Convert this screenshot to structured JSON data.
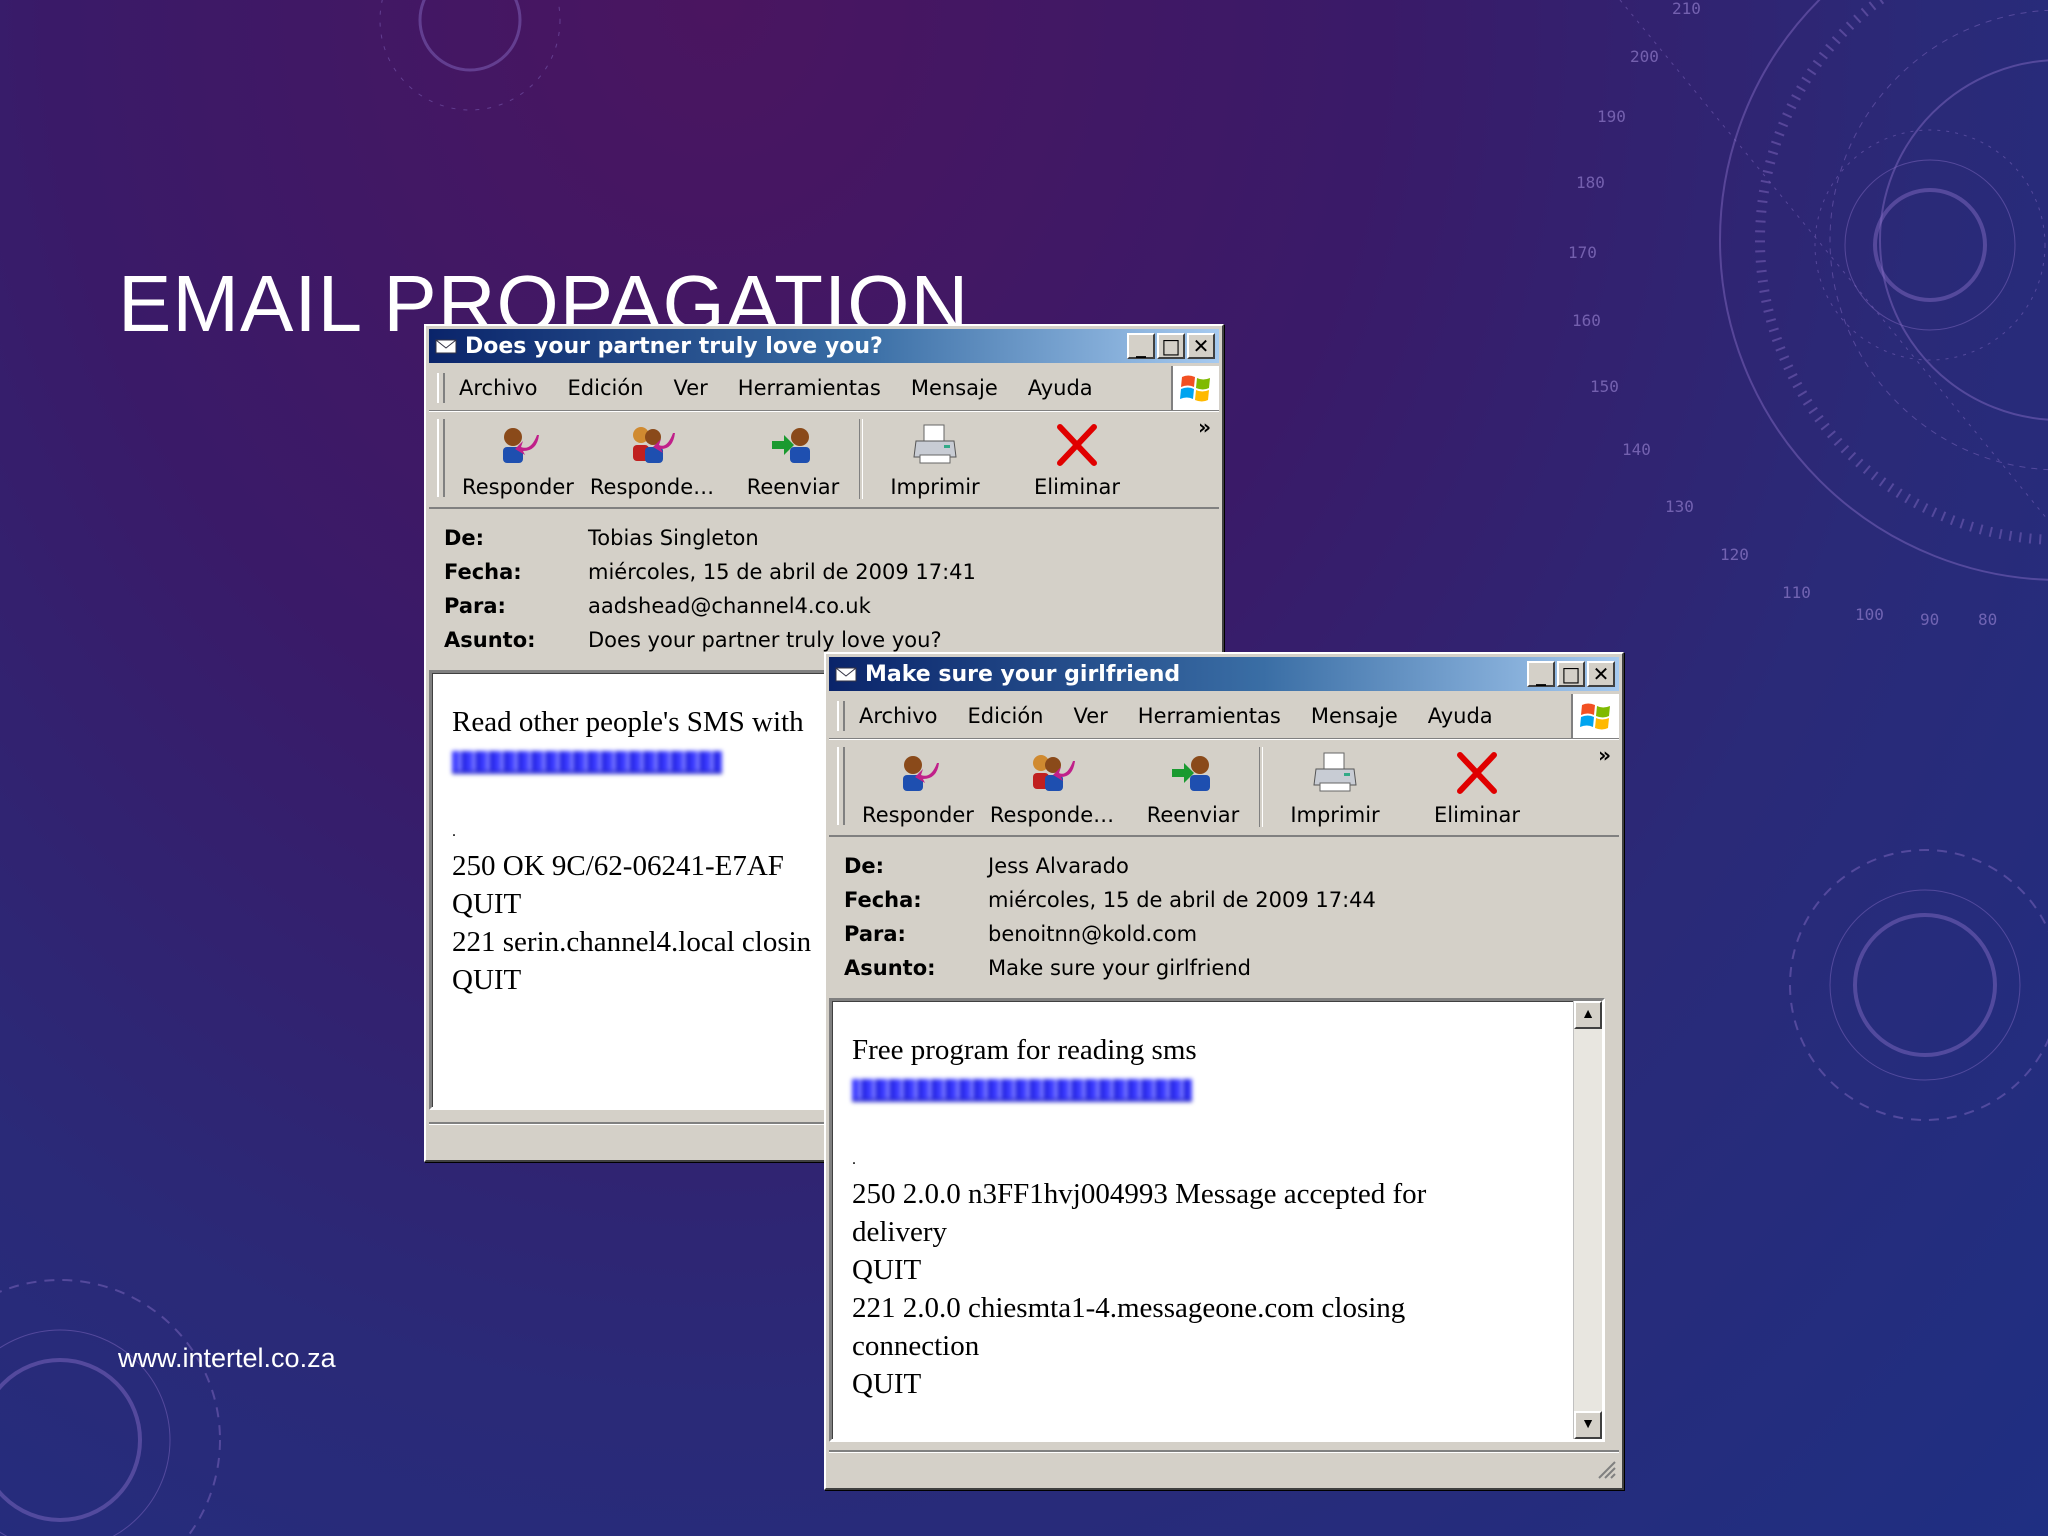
{
  "slide": {
    "title": "EMAIL PROPAGATION",
    "footer": "www.intertel.co.za"
  },
  "gauge_ticks": [
    "90",
    "100",
    "110",
    "120",
    "130",
    "140",
    "150",
    "160",
    "170",
    "180",
    "190",
    "200",
    "210",
    "80"
  ],
  "window1": {
    "title": "Does your partner truly love you?",
    "menu": [
      "Archivo",
      "Edición",
      "Ver",
      "Herramientas",
      "Mensaje",
      "Ayuda"
    ],
    "toolbar": [
      "Responder",
      "Responde…",
      "Reenviar",
      "Imprimir",
      "Eliminar"
    ],
    "headers": [
      {
        "label": "De:",
        "value": "Tobias Singleton"
      },
      {
        "label": "Fecha:",
        "value": "miércoles, 15 de abril de 2009 17:41"
      },
      {
        "label": "Para:",
        "value": "aadshead@channel4.co.uk"
      },
      {
        "label": "Asunto:",
        "value": "Does your partner truly love you?"
      }
    ],
    "body": [
      "Read other people's SMS with",
      "",
      "",
      ".",
      "250 OK 9C/62-06241-E7AF",
      "QUIT",
      "221 serin.channel4.local closin",
      "QUIT"
    ]
  },
  "window2": {
    "title": "Make sure your girlfriend",
    "menu": [
      "Archivo",
      "Edición",
      "Ver",
      "Herramientas",
      "Mensaje",
      "Ayuda"
    ],
    "toolbar": [
      "Responder",
      "Responde…",
      "Reenviar",
      "Imprimir",
      "Eliminar"
    ],
    "headers": [
      {
        "label": "De:",
        "value": "Jess Alvarado"
      },
      {
        "label": "Fecha:",
        "value": "miércoles, 15 de abril de 2009 17:44"
      },
      {
        "label": "Para:",
        "value": "benoitnn@kold.com"
      },
      {
        "label": "Asunto:",
        "value": "Make sure your girlfriend"
      }
    ],
    "body": [
      "Free program for reading sms",
      "",
      "",
      ".",
      "250 2.0.0 n3FF1hvj004993 Message accepted for",
      "delivery",
      "QUIT",
      "221 2.0.0 chiesmta1-4.messageone.com closing",
      "connection",
      "QUIT"
    ]
  },
  "icons": {
    "reply": "reply-icon",
    "reply_all": "reply-all-icon",
    "forward": "forward-icon",
    "print": "printer-icon",
    "delete": "delete-x-icon",
    "windows_logo": "windows-logo-icon",
    "mail": "envelope-icon"
  },
  "colors": {
    "titlebar_start": "#0a246a",
    "titlebar_end": "#a6caf0",
    "window_face": "#d4d0c8",
    "delete_red": "#e00000",
    "link_blue": "#3b3bff"
  }
}
